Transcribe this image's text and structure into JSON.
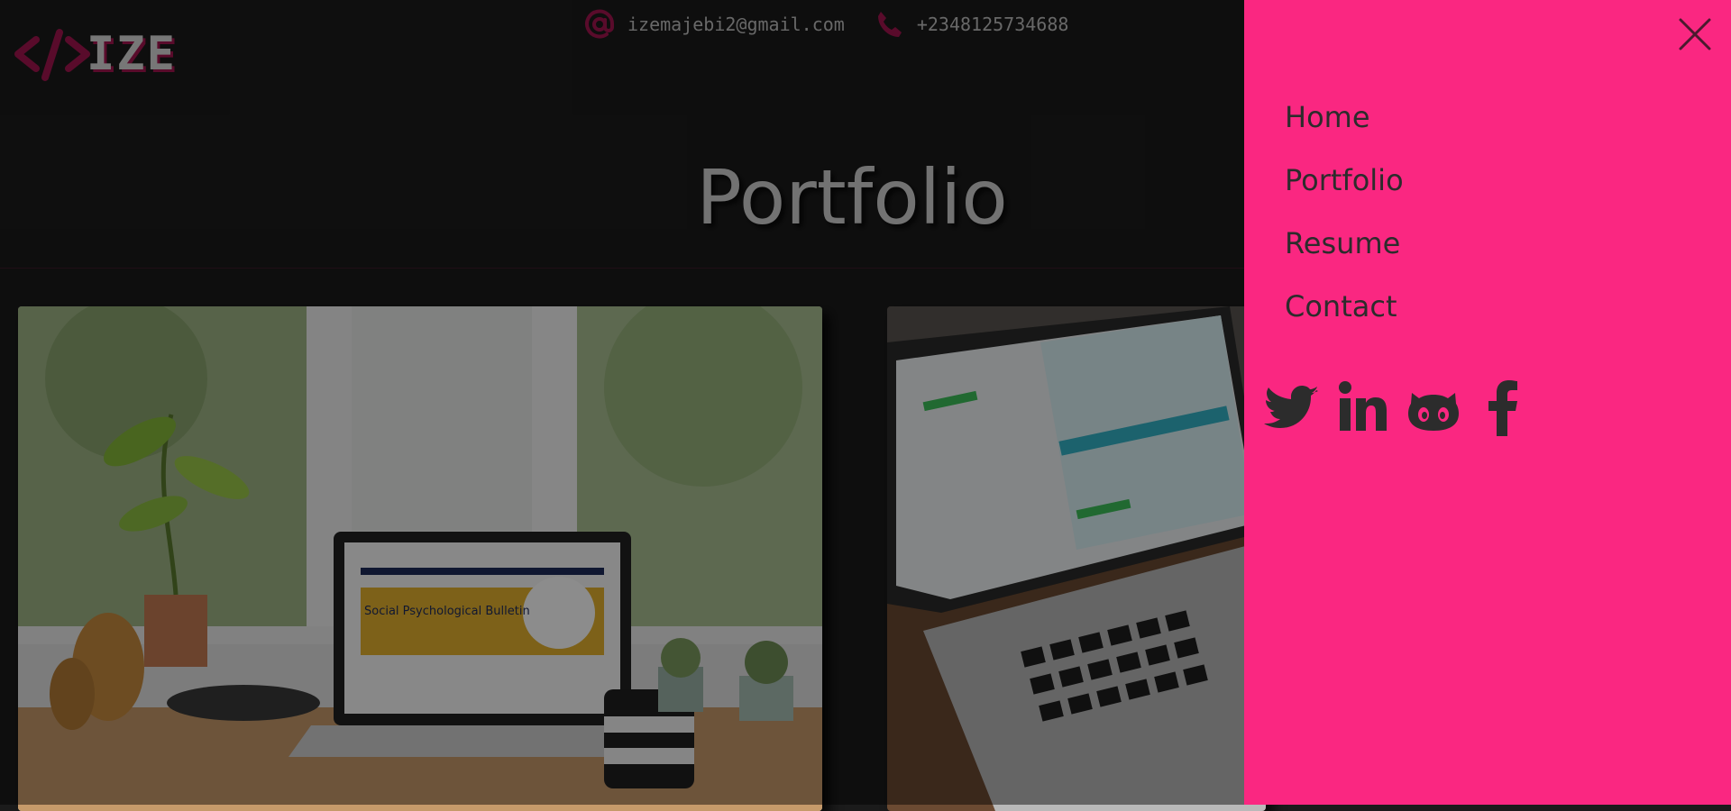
{
  "brand": {
    "name": "IZE",
    "accent": "#a3144f"
  },
  "contact": {
    "email": "izemajebi2@gmail.com",
    "phone": "+2348125734688"
  },
  "page": {
    "title": "Portfolio"
  },
  "projects": [
    {
      "image": "laptop-on-desk-social-psychological-bulletin",
      "screen_title": "Social Psychological Bulletin"
    },
    {
      "image": "macbook-pro-dashboard"
    }
  ],
  "menu": {
    "background": "#fa2781",
    "items": [
      {
        "label": "Home"
      },
      {
        "label": "Portfolio"
      },
      {
        "label": "Resume"
      },
      {
        "label": "Contact"
      }
    ],
    "socials": [
      "twitter-icon",
      "linkedin-icon",
      "github-icon",
      "facebook-icon"
    ]
  }
}
